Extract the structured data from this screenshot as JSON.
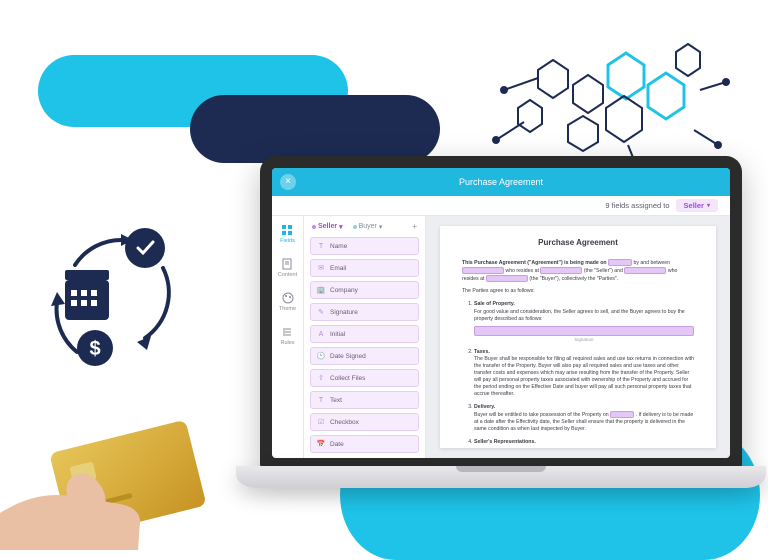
{
  "app": {
    "title": "Purchase Agreement",
    "close_icon": "×",
    "fields_assigned_label": "9 fields assigned to",
    "assigned_role": "Seller"
  },
  "rail": {
    "items": [
      {
        "id": "fields",
        "label": "Fields",
        "active": true
      },
      {
        "id": "content",
        "label": "Content",
        "active": false
      },
      {
        "id": "theme",
        "label": "Theme",
        "active": false
      },
      {
        "id": "rules",
        "label": "Rules",
        "active": false
      }
    ]
  },
  "fields_panel": {
    "tabs": [
      {
        "label": "Seller",
        "active": true
      },
      {
        "label": "Buyer",
        "active": false
      }
    ],
    "add_label": "+",
    "fields": [
      {
        "icon": "text",
        "label": "Name"
      },
      {
        "icon": "mail",
        "label": "Email"
      },
      {
        "icon": "building",
        "label": "Company"
      },
      {
        "icon": "pen",
        "label": "Signature"
      },
      {
        "icon": "initials",
        "label": "Initial"
      },
      {
        "icon": "clock",
        "label": "Date Signed"
      },
      {
        "icon": "upload",
        "label": "Collect Files"
      },
      {
        "icon": "text",
        "label": "Text"
      },
      {
        "icon": "check",
        "label": "Checkbox"
      },
      {
        "icon": "cal",
        "label": "Date"
      }
    ]
  },
  "document": {
    "heading": "Purchase Agreement",
    "intro1_a": "This Purchase Agreement (\"Agreement\") is being made on",
    "intro1_b": "by and between",
    "intro2_a": "who resides at",
    "intro2_seller": "(the \"Seller\") and",
    "intro2_c": "who resides at",
    "intro2_buyer": "(the \"Buyer\"), collectively the \"Parties\".",
    "agree_line": "The Parties agree to as follows:",
    "sections": [
      {
        "title": "Sale of Property.",
        "body": "For good value and consideration, the Seller agrees to sell, and the Buyer agrees to buy the property described as follows:",
        "signature_label": "Signature"
      },
      {
        "title": "Taxes.",
        "body": "The Buyer shall be responsible for filing all required sales and use tax returns in connection with the transfer of the Property. Buyer will also pay all required sales and use taxes and other transfer costs and expenses which may arise resulting from the transfer of the Property. Seller will pay all personal property taxes associated with ownership of the Property and accrued for the period ending on the Effective Date and buyer will pay all such personal property taxes that accrue thereafter."
      },
      {
        "title": "Delivery.",
        "body_a": "Buyer will be entitled to take possession of the Property on",
        "body_b": ". If delivery is to be made at a date after the Effectivity date, the Seller shall ensure that the property is delivered in the same condition as when last inspected by Buyer."
      },
      {
        "title": "Seller's Representations."
      }
    ]
  }
}
